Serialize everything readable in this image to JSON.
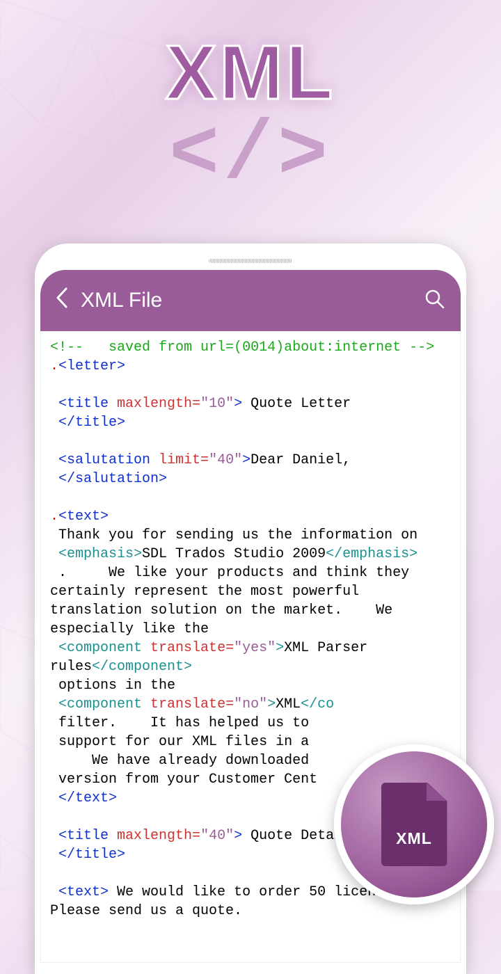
{
  "hero": {
    "title": "XML",
    "subtitle": "</>"
  },
  "appbar": {
    "title": "XML File"
  },
  "badge": {
    "label": "XML"
  },
  "xml": {
    "comment_open": "<!--",
    "comment_text": "saved from url=(0014)about:internet",
    "comment_close": "-->",
    "dot": ".",
    "letter_open": "<letter>",
    "title1_open1": "<title ",
    "title1_attr": "maxlength=",
    "title1_val": "\"10\"",
    "title1_open2": ">",
    "title1_text": " Quote Letter",
    "title1_close": "</title>",
    "salut_open1": "<salutation ",
    "salut_attr": "limit=",
    "salut_val": "\"40\"",
    "salut_open2": ">",
    "salut_text": "Dear Daniel,",
    "salut_close": "</salutation>",
    "text1_open": "<text>",
    "text1_p1": "Thank you for sending us the information on",
    "emph_open": "<emphasis>",
    "emph_text": "SDL Trados Studio 2009",
    "emph_close": "</emphasis>",
    "text1_p2": ".     We like your products and think they certainly represent the most powerful translation solution on the market.    We especially like the",
    "comp1_open1": "<component ",
    "comp_attr": "translate=",
    "comp1_val": "\"yes\"",
    "comp1_open2": ">",
    "comp1_text": "XML Parser rules",
    "comp1_close": "</component>",
    "text1_p3": "options in the",
    "comp2_open1": "<component ",
    "comp2_val": "\"no\"",
    "comp2_open2": ">",
    "comp2_text": "XML",
    "comp2_close": "</co",
    "text1_p4a": "filter.    It has helped us to ",
    "text1_p4b": "support for our XML files in a ",
    "text1_p4c": "    We have already downloaded ",
    "text1_p4d": "version from your Customer Cent",
    "text1_close": "</text>",
    "title2_open1": "<title ",
    "title2_attr": "maxlength=",
    "title2_val": "\"40\"",
    "title2_open2": ">",
    "title2_text": " Quote Detail",
    "title2_close": "</title>",
    "text2_open": "<text>",
    "text2_p1": " We would like to order 50 licenses.    Please send us a quote."
  }
}
